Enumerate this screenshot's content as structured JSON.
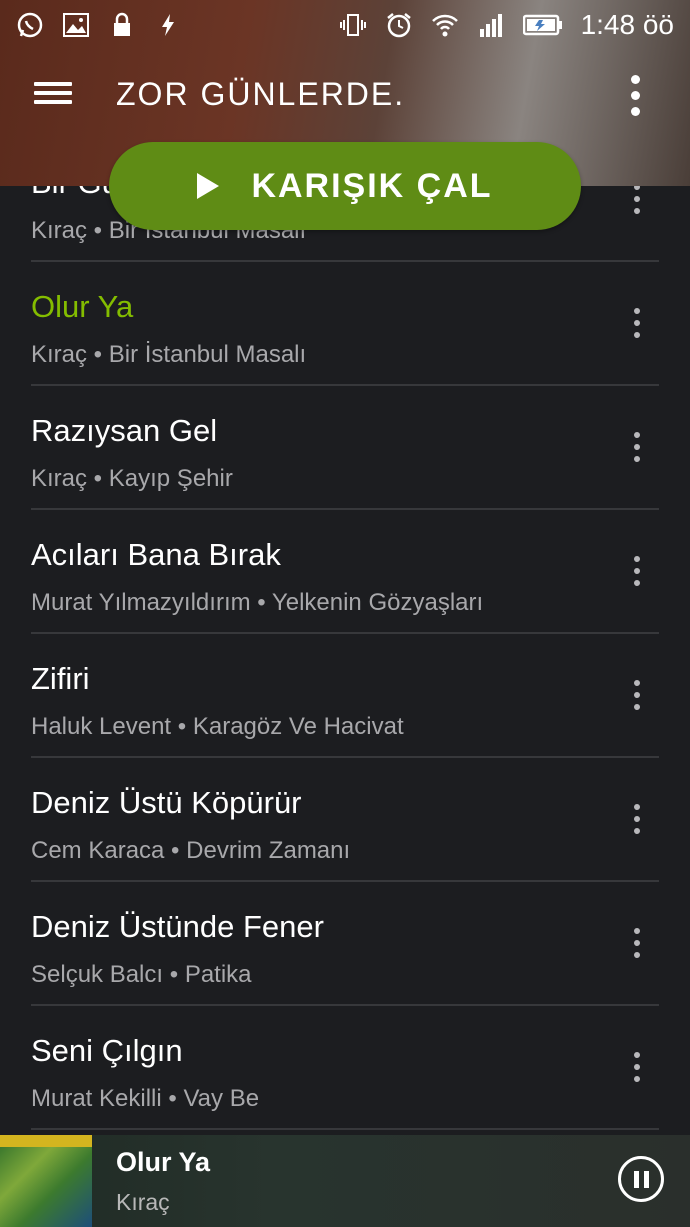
{
  "status_bar": {
    "time": "1:48 öö",
    "left_icons": [
      "whatsapp-icon",
      "image-icon",
      "lock-icon",
      "flash-icon"
    ],
    "right_icons": [
      "vibrate-icon",
      "alarm-icon",
      "wifi-icon",
      "signal-icon",
      "battery-charging-icon"
    ]
  },
  "header": {
    "title": "ZOR GÜNLERDE."
  },
  "shuffle_button": {
    "label": "KARIŞIK ÇAL"
  },
  "tracks": [
    {
      "title": "Bir Gün",
      "artist": "Kıraç",
      "album": "Bir İstanbul Masalı",
      "playing": false
    },
    {
      "title": "Olur Ya",
      "artist": "Kıraç",
      "album": "Bir İstanbul Masalı",
      "playing": true
    },
    {
      "title": "Razıysan Gel",
      "artist": "Kıraç",
      "album": "Kayıp Şehir",
      "playing": false
    },
    {
      "title": "Acıları Bana Bırak",
      "artist": "Murat Yılmazyıldırım",
      "album": "Yelkenin Gözyaşları",
      "playing": false
    },
    {
      "title": "Zifiri",
      "artist": "Haluk Levent",
      "album": "Karagöz Ve Hacivat",
      "playing": false
    },
    {
      "title": "Deniz Üstü Köpürür",
      "artist": "Cem Karaca",
      "album": "Devrim Zamanı",
      "playing": false
    },
    {
      "title": "Deniz Üstünde Fener",
      "artist": "Selçuk Balcı",
      "album": "Patika",
      "playing": false
    },
    {
      "title": "Seni Çılgın",
      "artist": "Murat Kekilli",
      "album": "Vay Be",
      "playing": false
    }
  ],
  "now_playing": {
    "title": "Olur Ya",
    "artist": "Kıraç"
  },
  "colors": {
    "accent_green": "#84bd00",
    "button_green": "#5f8c15",
    "background": "#1c1d20"
  }
}
